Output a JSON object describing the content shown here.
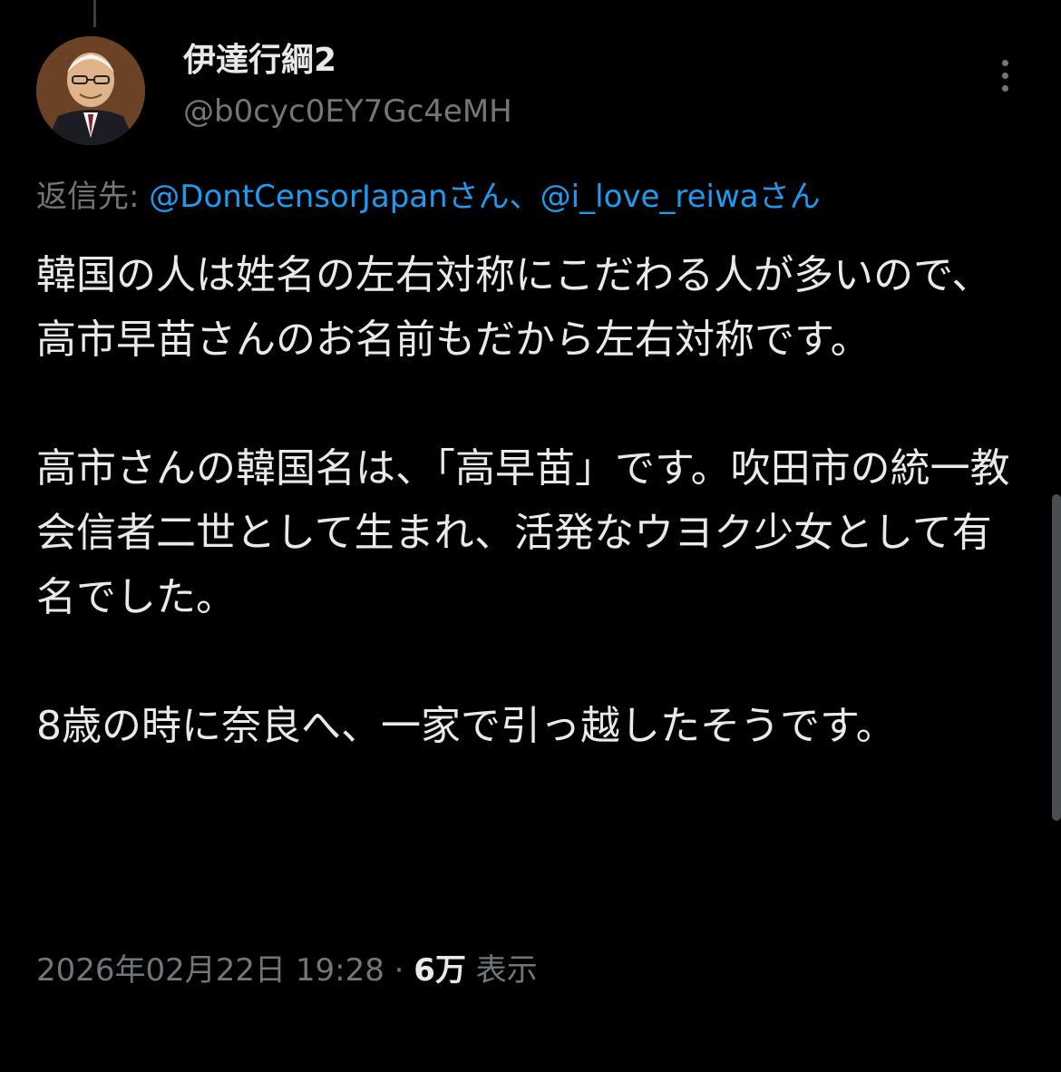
{
  "author": {
    "display_name": "伊達行綱2",
    "handle": "@b0cyc0EY7Gc4eMH",
    "avatar_icon": "profile-photo-icon"
  },
  "reply": {
    "prefix": "返信先: ",
    "mention_1": "@DontCensorJapanさん",
    "separator": "、",
    "mention_2": "@i_love_reiwaさん"
  },
  "tweet": {
    "paragraphs": [
      "韓国の人は姓名の左右対称にこだわる人が多いので、高市早苗さんのお名前もだから左右対称です。",
      "高市さんの韓国名は、「高早苗」です。吹田市の統一教会信者二世として生まれ、活発なウヨク少女として有名でした。",
      "8歳の時に奈良へ、一家で引っ越したそうです。"
    ]
  },
  "meta": {
    "timestamp": "2026年02月22日 19:28",
    "dot": " · ",
    "views_count": "6万",
    "views_label": " 表示"
  },
  "colors": {
    "background": "#000000",
    "text": "#e7e9ea",
    "secondary": "#71767b",
    "link": "#1d9bf0"
  },
  "icons": {
    "more": "more-vertical-icon"
  }
}
